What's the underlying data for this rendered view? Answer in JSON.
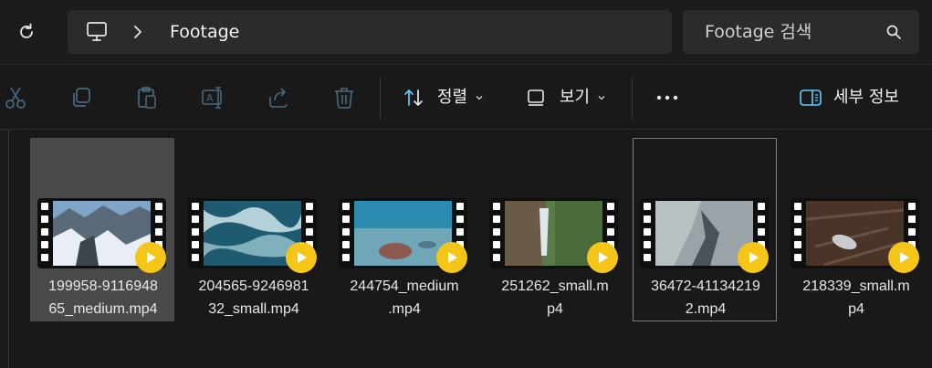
{
  "breadcrumb": {
    "current": "Footage"
  },
  "search": {
    "placeholder": "Footage 검색"
  },
  "toolbar": {
    "sort_label": "정렬",
    "view_label": "보기",
    "details_label": "세부 정보"
  },
  "files": [
    {
      "name": "199958-911694865_medium.mp4",
      "line1": "199958-9116948",
      "line2": "65_medium.mp4"
    },
    {
      "name": "204565-924698132_small.mp4",
      "line1": "204565-9246981",
      "line2": "32_small.mp4"
    },
    {
      "name": "244754_medium.mp4",
      "line1": "244754_medium",
      "line2": ".mp4"
    },
    {
      "name": "251262_small.mp4",
      "line1": "251262_small.m",
      "line2": "p4"
    },
    {
      "name": "36472-411342192.mp4",
      "line1": "36472-41134219",
      "line2": "2.mp4"
    },
    {
      "name": "218339_small.mp4",
      "line1": "218339_small.m",
      "line2": "p4"
    }
  ],
  "colors": {
    "accent": "#60cdff",
    "play": "#f5c518"
  }
}
